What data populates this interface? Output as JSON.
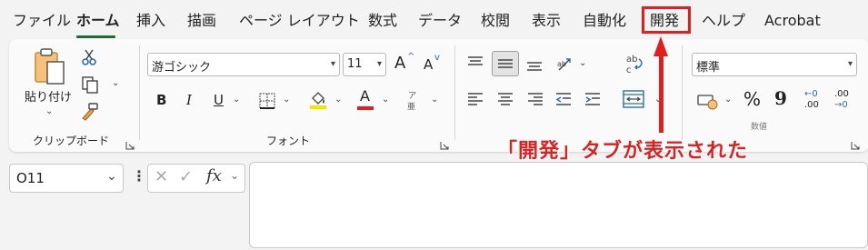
{
  "menu": {
    "tabs": [
      "ファイル",
      "ホーム",
      "挿入",
      "描画",
      "ページ レイアウト",
      "数式",
      "データ",
      "校閲",
      "表示",
      "自動化",
      "開発",
      "ヘルプ",
      "Acrobat"
    ]
  },
  "clipboard": {
    "paste_label": "貼り付け",
    "group_label": "クリップボード"
  },
  "font": {
    "font_name": "游ゴシック",
    "font_size": "11",
    "bold": "B",
    "italic": "I",
    "underline": "U",
    "font_color_letter": "A",
    "furigana": "ア",
    "grow": "A",
    "shrink": "A",
    "group_label": "フォント"
  },
  "alignment": {
    "wrap_top": "ab",
    "wrap_bottom": "c"
  },
  "number": {
    "format": "標準",
    "percent": "%",
    "comma": "9",
    "inc_decimal_top": "←0",
    "inc_decimal_bottom": ".00",
    "dec_decimal_top": ".00",
    "dec_decimal_bottom": "→0",
    "group_label": "数値"
  },
  "formula_bar": {
    "name_box": "O11",
    "fx": "fx"
  },
  "annotation": {
    "text": "「開発」タブが表示された"
  },
  "colors": {
    "highlight_red": "#e01f1f",
    "active_tab_underline": "#1e6c3a",
    "fill_yellow": "#f5e400",
    "font_red": "#e01f1f"
  }
}
